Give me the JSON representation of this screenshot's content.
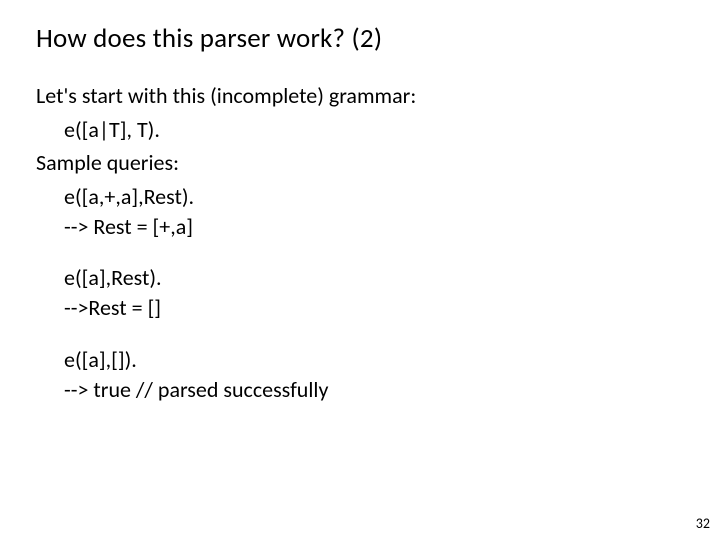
{
  "title": "How does this parser work? (2)",
  "intro": "Let's start with this (incomplete) grammar:",
  "grammar": "e([a|T], T).",
  "sample_heading": "Sample queries:",
  "queries": [
    {
      "call": "e([a,+,a],Rest).",
      "result": "--> Rest = [+,a]"
    },
    {
      "call": "e([a],Rest).",
      "result": "-->Rest = []"
    },
    {
      "call": "e([a],[]).",
      "result": "--> true   // parsed successfully"
    }
  ],
  "page_number": "32"
}
